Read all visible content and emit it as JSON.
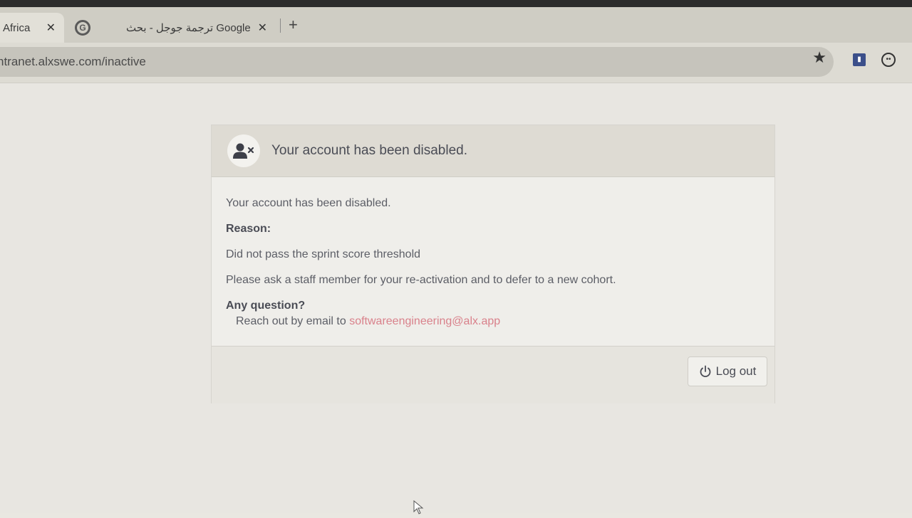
{
  "browser": {
    "tabs": [
      {
        "label": "Africa",
        "close": "✕"
      },
      {
        "label": "Google ترجمة جوجل - بحث",
        "close": "✕"
      }
    ],
    "new_tab": "+",
    "url": "ntranet.alxswe.com/inactive",
    "star_icon": "star-icon",
    "extension_icons": [
      "extension-icon",
      "profile-icon"
    ]
  },
  "card": {
    "header_title": "Your account has been disabled.",
    "header_icon": "user-disabled-icon",
    "body": {
      "message": "Your account has been disabled.",
      "reason_label": "Reason:",
      "reason_text": "Did not pass the sprint score threshold",
      "instructions": "Please ask a staff member for your re-activation and to defer to a new cohort.",
      "question_label": "Any question?",
      "contact_prefix": "Reach out by email to",
      "contact_email": "softwareengineering@alx.app"
    },
    "footer": {
      "logout_label": "Log out",
      "logout_icon": "power-icon"
    }
  },
  "colors": {
    "link": "#d9818b",
    "header_bg": "#dedbd3"
  }
}
